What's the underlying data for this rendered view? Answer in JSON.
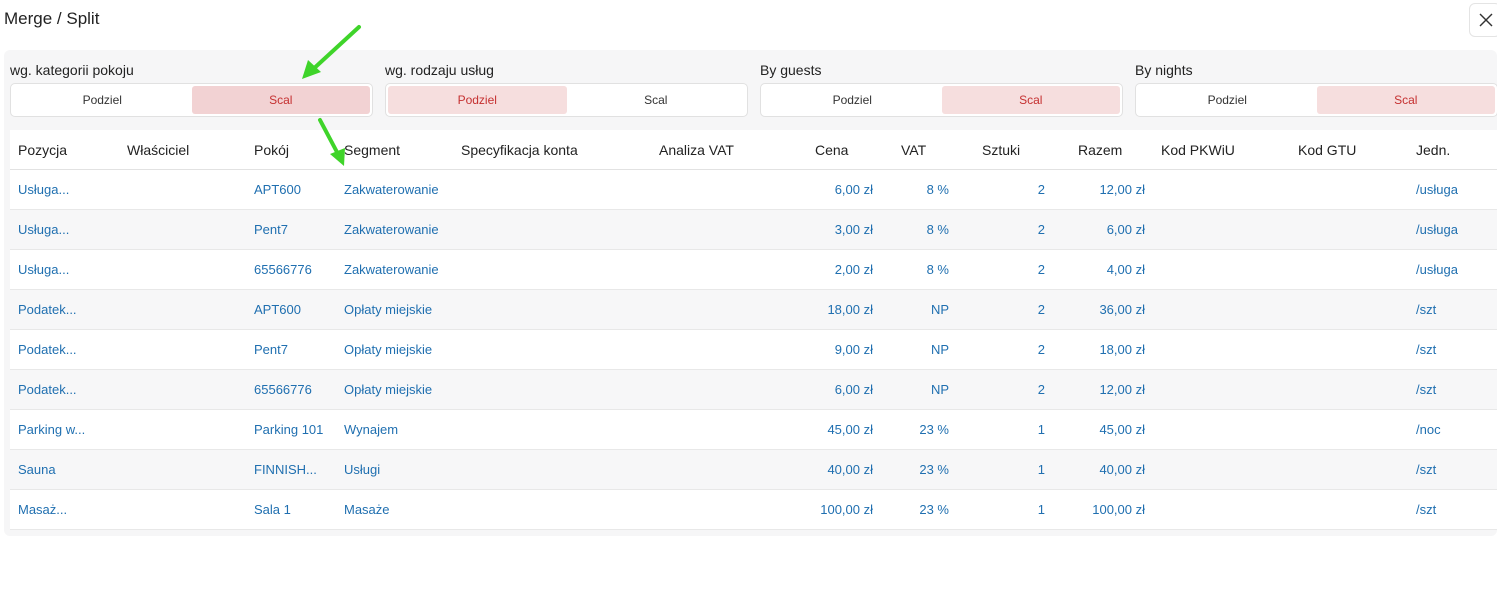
{
  "title": "Merge / Split",
  "close_icon": "close-icon",
  "groups": [
    {
      "label": "wg. kategorii pokoju",
      "split": "Podziel",
      "merge": "Scal",
      "active": "merge"
    },
    {
      "label": "wg. rodzaju usług",
      "split": "Podziel",
      "merge": "Scal",
      "active": "split"
    },
    {
      "label": "By guests",
      "split": "Podziel",
      "merge": "Scal",
      "active": "merge"
    },
    {
      "label": "By nights",
      "split": "Podziel",
      "merge": "Scal",
      "active": "merge"
    }
  ],
  "columns": [
    "Pozycja",
    "Właściciel",
    "Pokój",
    "Segment",
    "Specyfikacja konta",
    "Analiza VAT",
    "Cena",
    "VAT",
    "Sztuki",
    "Razem",
    "Kod PKWiU",
    "Kod GTU",
    "Jedn."
  ],
  "rows": [
    {
      "pozycja": "Usługa...",
      "wlasciciel": "",
      "pokoj": "APT600",
      "segment": "Zakwaterowanie",
      "cena": "6,00 zł",
      "vat": "8 %",
      "sztuki": "2",
      "razem": "12,00 zł",
      "jedn": "/usługa"
    },
    {
      "pozycja": "Usługa...",
      "wlasciciel": "",
      "pokoj": "Pent7",
      "segment": "Zakwaterowanie",
      "cena": "3,00 zł",
      "vat": "8 %",
      "sztuki": "2",
      "razem": "6,00 zł",
      "jedn": "/usługa"
    },
    {
      "pozycja": "Usługa...",
      "wlasciciel": "",
      "pokoj": "65566776",
      "segment": "Zakwaterowanie",
      "cena": "2,00 zł",
      "vat": "8 %",
      "sztuki": "2",
      "razem": "4,00 zł",
      "jedn": "/usługa"
    },
    {
      "pozycja": "Podatek...",
      "wlasciciel": "",
      "pokoj": "APT600",
      "segment": "Opłaty miejskie",
      "cena": "18,00 zł",
      "vat": "NP",
      "sztuki": "2",
      "razem": "36,00 zł",
      "jedn": "/szt"
    },
    {
      "pozycja": "Podatek...",
      "wlasciciel": "",
      "pokoj": "Pent7",
      "segment": "Opłaty miejskie",
      "cena": "9,00 zł",
      "vat": "NP",
      "sztuki": "2",
      "razem": "18,00 zł",
      "jedn": "/szt"
    },
    {
      "pozycja": "Podatek...",
      "wlasciciel": "",
      "pokoj": "65566776",
      "segment": "Opłaty miejskie",
      "cena": "6,00 zł",
      "vat": "NP",
      "sztuki": "2",
      "razem": "12,00 zł",
      "jedn": "/szt"
    },
    {
      "pozycja": "Parking w...",
      "wlasciciel": "",
      "pokoj": "Parking 101",
      "segment": "Wynajem",
      "cena": "45,00 zł",
      "vat": "23 %",
      "sztuki": "1",
      "razem": "45,00 zł",
      "jedn": "/noc"
    },
    {
      "pozycja": "Sauna",
      "wlasciciel": "",
      "pokoj": "FINNISH...",
      "segment": "Usługi",
      "cena": "40,00 zł",
      "vat": "23 %",
      "sztuki": "1",
      "razem": "40,00 zł",
      "jedn": "/szt"
    },
    {
      "pozycja": "Masaż...",
      "wlasciciel": "",
      "pokoj": "Sala 1",
      "segment": "Masaże",
      "cena": "100,00 zł",
      "vat": "23 %",
      "sztuki": "1",
      "razem": "100,00 zł",
      "jedn": "/szt"
    }
  ],
  "annotation_color": "#3fd42a"
}
